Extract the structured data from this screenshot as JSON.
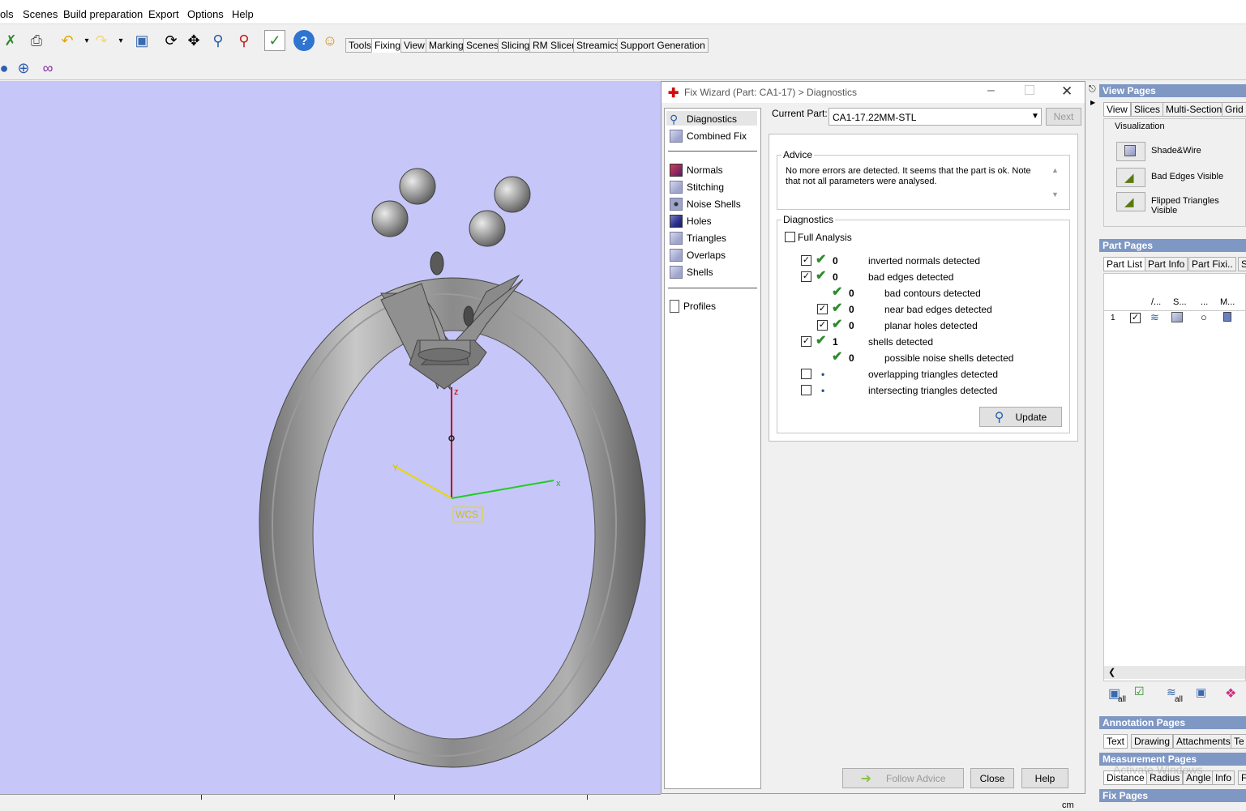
{
  "menu": [
    "ols",
    "Scenes",
    "Build preparation",
    "Export",
    "Options",
    "Help"
  ],
  "toolbar_tabs": [
    "Tools",
    "Fixing",
    "View",
    "Marking",
    "Scenes",
    "Slicing",
    "RM Slicer",
    "Streamics",
    "Support Generation"
  ],
  "viewport": {
    "axis_z": "z",
    "axis_x": "x",
    "axis_y": "Y",
    "wcs": "WCS",
    "ruler_unit": "cm"
  },
  "wizard": {
    "title": "Fix Wizard (Part: CA1-17) > Diagnostics",
    "nav": {
      "top": [
        "Diagnostics",
        "Combined Fix"
      ],
      "fix": [
        "Normals",
        "Stitching",
        "Noise Shells",
        "Holes",
        "Triangles",
        "Overlaps",
        "Shells"
      ],
      "bottom": [
        "Profiles"
      ]
    },
    "current_part_label": "Current Part:",
    "current_part_value": "CA1-17.22MM-STL",
    "next_label": "Next",
    "advice_label": "Advice",
    "advice_text": "No more errors are detected. It seems that the part is ok. Note that not all parameters were analysed.",
    "diagnostics_label": "Diagnostics",
    "full_analysis_label": "Full Analysis",
    "rows": [
      {
        "num": "0",
        "label": "inverted normals detected"
      },
      {
        "num": "0",
        "label": "bad edges detected"
      },
      {
        "num": "0",
        "label": "bad contours detected"
      },
      {
        "num": "0",
        "label": "near bad edges detected"
      },
      {
        "num": "0",
        "label": "planar holes detected"
      },
      {
        "num": "1",
        "label": "shells detected"
      },
      {
        "num": "0",
        "label": "possible noise shells detected"
      },
      {
        "num": "",
        "label": "overlapping triangles detected"
      },
      {
        "num": "",
        "label": "intersecting triangles detected"
      }
    ],
    "update_label": "Update",
    "follow_advice_label": "Follow Advice",
    "close_label": "Close",
    "help_label": "Help"
  },
  "right": {
    "view_pages": "View Pages",
    "view_tabs": [
      "View",
      "Slices",
      "Multi-Section",
      "Grid"
    ],
    "visualization": "Visualization",
    "vis_items": [
      "Shade&Wire",
      "Bad Edges Visible",
      "Flipped Triangles Visible"
    ],
    "part_pages": "Part Pages",
    "part_tabs": [
      "Part List",
      "Part Info",
      "Part Fixi..",
      "S"
    ],
    "part_cols": [
      "/...",
      "S...",
      "...",
      "M..."
    ],
    "part_row_num": "1",
    "all_label": "all",
    "annotation_pages": "Annotation Pages",
    "annotation_tabs": [
      "Text",
      "Drawing",
      "Attachments",
      "Te"
    ],
    "measurement_pages": "Measurement Pages",
    "measurement_tabs": [
      "Distance",
      "Radius",
      "Angle",
      "Info",
      "F"
    ],
    "fix_pages": "Fix Pages",
    "watermark": "Activate Windows"
  }
}
